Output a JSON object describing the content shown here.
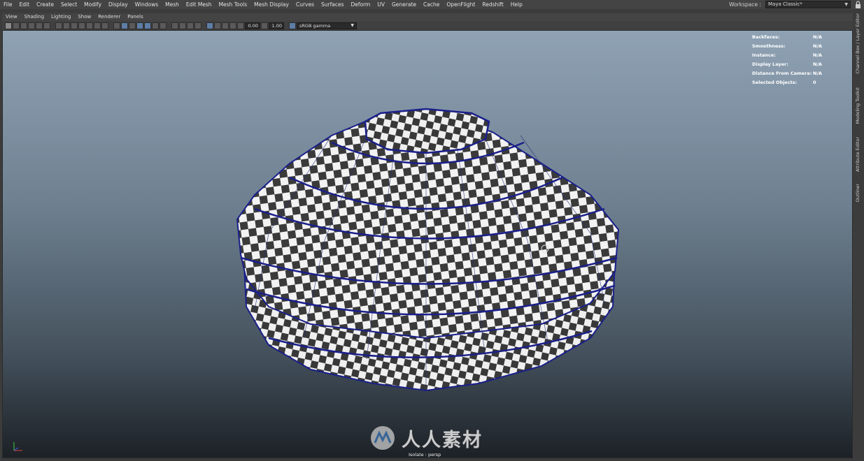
{
  "main_menu": [
    "File",
    "Edit",
    "Create",
    "Select",
    "Modify",
    "Display",
    "Windows",
    "Mesh",
    "Edit Mesh",
    "Mesh Tools",
    "Mesh Display",
    "Curves",
    "Surfaces",
    "Deform",
    "UV",
    "Generate",
    "Cache",
    "OpenFlight",
    "Redshift",
    "Help"
  ],
  "workspace": {
    "label": "Workspace :",
    "value": "Maya Classic*"
  },
  "panel_menu": [
    "View",
    "Shading",
    "Lighting",
    "Show",
    "Renderer",
    "Panels"
  ],
  "toolbar": {
    "exposure": "0.00",
    "gamma": "1.00",
    "color_space": "sRGB gamma"
  },
  "hud": [
    {
      "key": "Backfaces:",
      "value": "N/A"
    },
    {
      "key": "Smoothness:",
      "value": "N/A"
    },
    {
      "key": "Instance:",
      "value": "N/A"
    },
    {
      "key": "Display Layer:",
      "value": "N/A"
    },
    {
      "key": "Distance From Camera:",
      "value": "N/A"
    },
    {
      "key": "Selected Objects:",
      "value": "0"
    }
  ],
  "isolate_label": "Isolate : persp",
  "watermark_text": "人人素材",
  "right_tabs": [
    "Channel Box / Layer Editor",
    "Modeling Toolkit",
    "Attribute Editor",
    "Outliner"
  ],
  "colors": {
    "viewport_top": "#8fa2b4",
    "viewport_bottom": "#1c2126",
    "wireframe": "#1a1f8a",
    "menubar": "#444444"
  }
}
